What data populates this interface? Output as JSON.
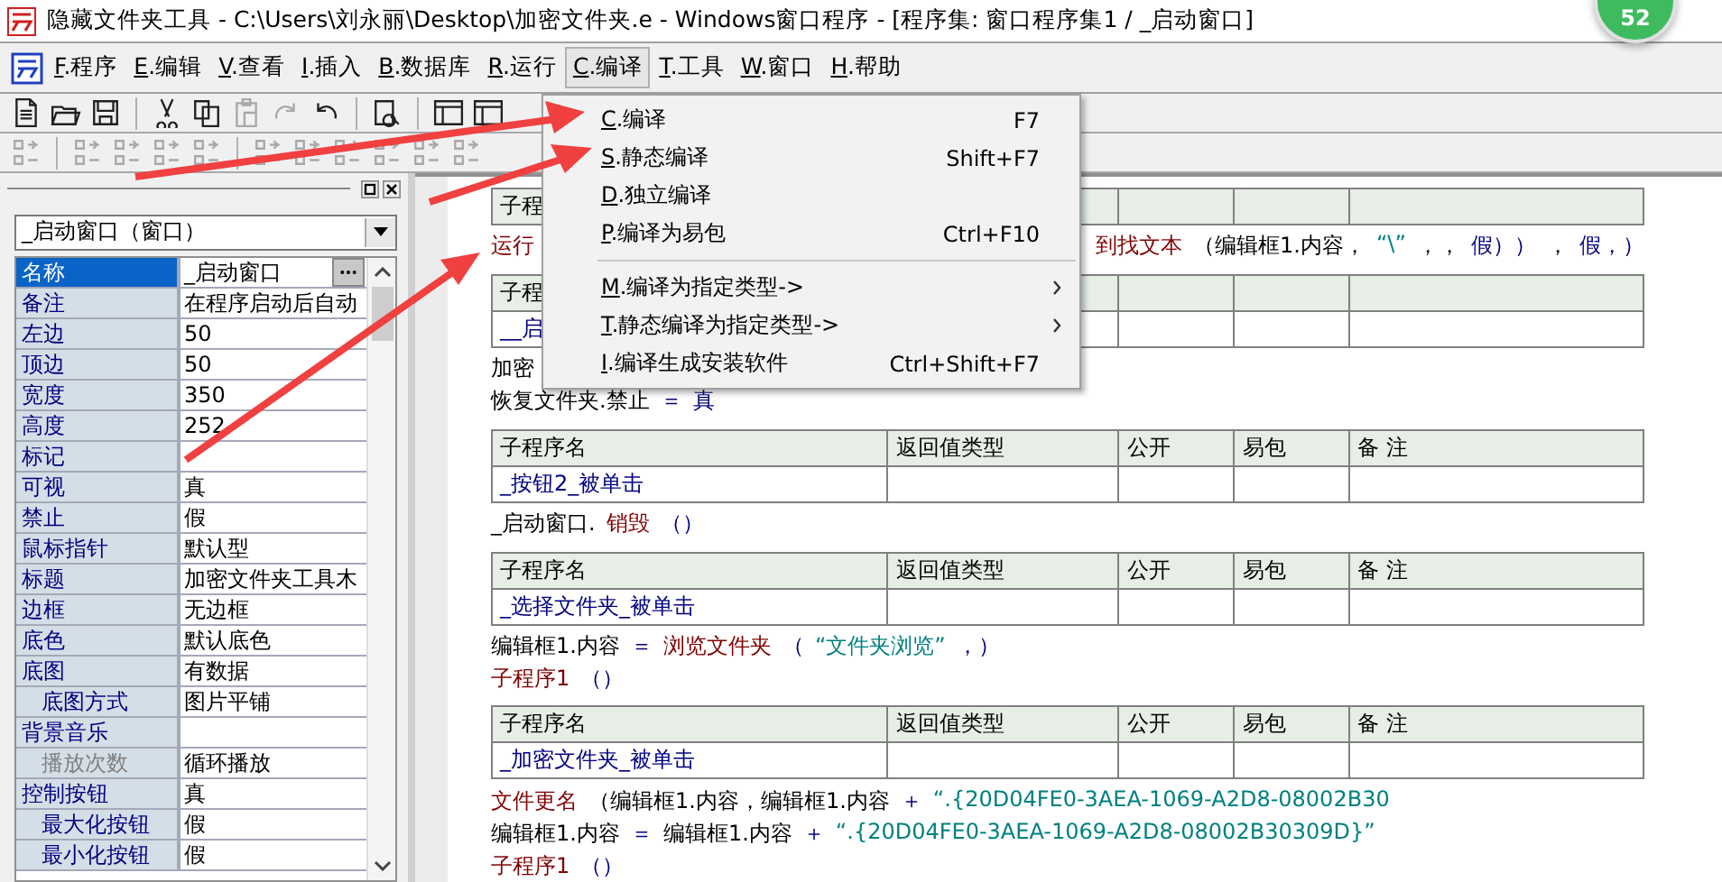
{
  "window": {
    "title": "隐藏文件夹工具 - C:\\Users\\刘永丽\\Desktop\\加密文件夹.e - Windows窗口程序 - [程序集: 窗口程序集1 / _启动窗口]"
  },
  "badge": "52",
  "menu": [
    {
      "key": "F",
      "label": ".程序",
      "selected": false
    },
    {
      "key": "E",
      "label": ".编辑",
      "selected": false
    },
    {
      "key": "V",
      "label": ".查看",
      "selected": false
    },
    {
      "key": "I",
      "label": ".插入",
      "selected": false
    },
    {
      "key": "B",
      "label": ".数据库",
      "selected": false
    },
    {
      "key": "R",
      "label": ".运行",
      "selected": false
    },
    {
      "key": "C",
      "label": ".编译",
      "selected": true
    },
    {
      "key": "T",
      "label": ".工具",
      "selected": false
    },
    {
      "key": "W",
      "label": ".窗口",
      "selected": false
    },
    {
      "key": "H",
      "label": ".帮助",
      "selected": false
    }
  ],
  "toolbar_1": [
    {
      "kind": "new",
      "disabled": false
    },
    {
      "kind": "open",
      "disabled": false
    },
    {
      "kind": "save",
      "disabled": false
    },
    {
      "kind": "sep"
    },
    {
      "kind": "cut",
      "disabled": false
    },
    {
      "kind": "copy",
      "disabled": false
    },
    {
      "kind": "paste",
      "disabled": true
    },
    {
      "kind": "redo",
      "disabled": true
    },
    {
      "kind": "undo",
      "disabled": false
    },
    {
      "kind": "sep"
    },
    {
      "kind": "find",
      "disabled": false
    },
    {
      "kind": "sep"
    },
    {
      "kind": "layout",
      "disabled": false
    },
    {
      "kind": "layout",
      "disabled": false
    }
  ],
  "toolbar_2": [
    {
      "kind": "align",
      "disabled": true
    },
    {
      "kind": "sep"
    },
    {
      "kind": "align",
      "disabled": true
    },
    {
      "kind": "align",
      "disabled": true
    },
    {
      "kind": "align",
      "disabled": true
    },
    {
      "kind": "align",
      "disabled": true
    },
    {
      "kind": "sep"
    },
    {
      "kind": "align",
      "disabled": true
    },
    {
      "kind": "align",
      "disabled": true
    },
    {
      "kind": "align",
      "disabled": true
    },
    {
      "kind": "align",
      "disabled": true
    },
    {
      "kind": "align",
      "disabled": true
    },
    {
      "kind": "align",
      "disabled": true
    }
  ],
  "compile_menu": [
    {
      "kind": "item",
      "key": "C",
      "label": ".编译",
      "shortcut": "F7"
    },
    {
      "kind": "item",
      "key": "S",
      "label": ".静态编译",
      "shortcut": "Shift+F7"
    },
    {
      "kind": "item",
      "key": "D",
      "label": ".独立编译"
    },
    {
      "kind": "item",
      "key": "P",
      "label": ".编译为易包",
      "shortcut": "Ctrl+F10"
    },
    {
      "kind": "separator"
    },
    {
      "kind": "submenu",
      "key": "M",
      "label": ".编译为指定类型->"
    },
    {
      "kind": "submenu",
      "key": "T",
      "label": ".静态编译为指定类型->"
    },
    {
      "kind": "item",
      "key": "I",
      "label": ".编译生成安装软件",
      "shortcut": "Ctrl+Shift+F7"
    }
  ],
  "properties": {
    "object": "_启动窗口（窗口）",
    "rows": [
      {
        "name": "名称",
        "value": "_启动窗口",
        "selected": true,
        "indent": false,
        "disabled": false,
        "has_button": true
      },
      {
        "name": "备注",
        "value": "在程序启动后自动",
        "selected": false,
        "indent": false,
        "disabled": false
      },
      {
        "name": "左边",
        "value": "50",
        "selected": false,
        "indent": false,
        "disabled": false
      },
      {
        "name": "顶边",
        "value": "50",
        "selected": false,
        "indent": false,
        "disabled": false
      },
      {
        "name": "宽度",
        "value": "350",
        "selected": false,
        "indent": false,
        "disabled": false
      },
      {
        "name": "高度",
        "value": "252",
        "selected": false,
        "indent": false,
        "disabled": false
      },
      {
        "name": "标记",
        "selected": false,
        "indent": false,
        "disabled": false
      },
      {
        "name": "可视",
        "value": "真",
        "selected": false,
        "indent": false,
        "disabled": false
      },
      {
        "name": "禁止",
        "value": "假",
        "selected": false,
        "indent": false,
        "disabled": false
      },
      {
        "name": "鼠标指针",
        "value": "默认型",
        "selected": false,
        "indent": false,
        "disabled": false
      },
      {
        "name": "标题",
        "value": "加密文件夹工具木",
        "selected": false,
        "indent": false,
        "disabled": false
      },
      {
        "name": "边框",
        "value": "无边框",
        "selected": false,
        "indent": false,
        "disabled": false
      },
      {
        "name": "底色",
        "value": "默认底色",
        "selected": false,
        "indent": false,
        "disabled": false
      },
      {
        "name": "底图",
        "value": "有数据",
        "selected": false,
        "indent": false,
        "disabled": false
      },
      {
        "name": "底图方式",
        "value": "图片平铺",
        "selected": false,
        "indent": true,
        "disabled": false
      },
      {
        "name": "背景音乐",
        "selected": false,
        "indent": false,
        "disabled": false
      },
      {
        "name": "播放次数",
        "value": "循环播放",
        "selected": false,
        "indent": true,
        "disabled": true
      },
      {
        "name": "控制按钮",
        "value": "真",
        "selected": false,
        "indent": false,
        "disabled": false
      },
      {
        "name": "最大化按钮",
        "value": "假",
        "selected": false,
        "indent": true,
        "disabled": false
      },
      {
        "name": "最小化按钮",
        "value": "假",
        "selected": false,
        "indent": true,
        "disabled": false
      }
    ]
  },
  "code": [
    {
      "kind": "table",
      "header": [
        "子程"
      ]
    },
    {
      "kind": "line",
      "segments": [
        {
          "kind": "func",
          "text": "运行"
        }
      ],
      "tail": [
        {
          "kind": "func",
          "text": "到找文本"
        },
        {
          "kind": "plain",
          "text": "（编辑框1.内容，"
        },
        {
          "kind": "str",
          "text": "“\\”"
        },
        {
          "kind": "plain",
          "text": "，，"
        },
        {
          "kind": "op",
          "text": "假））"
        },
        {
          "kind": "plain",
          "text": "，"
        },
        {
          "kind": "op",
          "text": "假，）"
        }
      ]
    },
    {
      "kind": "table",
      "header": [
        "子程"
      ],
      "cells": [
        "__启"
      ]
    },
    {
      "kind": "line",
      "segments": [
        {
          "kind": "plain",
          "text": "加密"
        }
      ]
    },
    {
      "kind": "line",
      "segments": [
        {
          "kind": "plain",
          "text": "恢复文件夹.禁止"
        },
        {
          "kind": "op",
          "text": "＝"
        },
        {
          "kind": "op",
          "text": "真"
        }
      ]
    },
    {
      "kind": "table",
      "header": [
        "子程序名",
        "返回值类型",
        "公开",
        "易包",
        "备 注"
      ],
      "cells": [
        "_按钮2_被单击"
      ]
    },
    {
      "kind": "line",
      "segments": [
        {
          "kind": "plain",
          "text": "_启动窗口."
        },
        {
          "kind": "func",
          "text": "销毁"
        },
        {
          "kind": "op",
          "text": "（）"
        }
      ]
    },
    {
      "kind": "table",
      "header": [
        "子程序名",
        "返回值类型",
        "公开",
        "易包",
        "备 注"
      ],
      "cells": [
        "_选择文件夹_被单击"
      ]
    },
    {
      "kind": "line",
      "segments": [
        {
          "kind": "plain",
          "text": "编辑框1.内容"
        },
        {
          "kind": "op",
          "text": "＝"
        },
        {
          "kind": "func",
          "text": "浏览文件夹"
        },
        {
          "kind": "op",
          "text": "（"
        },
        {
          "kind": "str",
          "text": "“文件夹浏览”"
        },
        {
          "kind": "op",
          "text": "，）"
        }
      ]
    },
    {
      "kind": "line",
      "segments": [
        {
          "kind": "func",
          "text": "子程序1"
        },
        {
          "kind": "op",
          "text": "（）"
        }
      ]
    },
    {
      "kind": "table",
      "header": [
        "子程序名",
        "返回值类型",
        "公开",
        "易包",
        "备 注"
      ],
      "cells": [
        "_加密文件夹_被单击"
      ]
    },
    {
      "kind": "line",
      "segments": [
        {
          "kind": "func",
          "text": "文件更名"
        },
        {
          "kind": "plain",
          "text": "（编辑框1.内容，编辑框1.内容"
        },
        {
          "kind": "op",
          "text": "＋"
        },
        {
          "kind": "str",
          "text": "“.{20D04FE0-3AEA-1069-A2D8-08002B30"
        }
      ]
    },
    {
      "kind": "line",
      "segments": [
        {
          "kind": "plain",
          "text": "编辑框1.内容"
        },
        {
          "kind": "op",
          "text": "＝"
        },
        {
          "kind": "plain",
          "text": "编辑框1.内容"
        },
        {
          "kind": "op",
          "text": "＋"
        },
        {
          "kind": "str",
          "text": "“.{20D04FE0-3AEA-1069-A2D8-08002B30309D}”"
        }
      ]
    },
    {
      "kind": "line",
      "segments": [
        {
          "kind": "func",
          "text": "子程序1"
        },
        {
          "kind": "op",
          "text": "（）"
        }
      ]
    }
  ]
}
